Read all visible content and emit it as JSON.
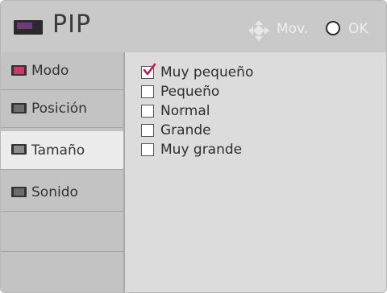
{
  "header": {
    "title": "PIP",
    "title_icon": "pip-icon",
    "hints": [
      {
        "icon": "directional-pad-icon",
        "label": "Mov."
      },
      {
        "icon": "ok-button-icon",
        "label": "OK"
      }
    ]
  },
  "sidebar": {
    "items": [
      {
        "label": "Modo",
        "icon": "mode-icon",
        "active": false
      },
      {
        "label": "Posición",
        "icon": "position-icon",
        "active": false
      },
      {
        "label": "Tamaño",
        "icon": "size-icon",
        "active": true
      },
      {
        "label": "Sonido",
        "icon": "sound-icon",
        "active": false
      }
    ]
  },
  "size_options": [
    {
      "label": "Muy pequeño",
      "checked": true
    },
    {
      "label": "Pequeño",
      "checked": false
    },
    {
      "label": "Normal",
      "checked": false
    },
    {
      "label": "Grande",
      "checked": false
    },
    {
      "label": "Muy grande",
      "checked": false
    }
  ],
  "colors": {
    "check_accent": "#c2185b",
    "header_bg": "#c9c9c9",
    "panel_bg": "#dcdcdc"
  }
}
